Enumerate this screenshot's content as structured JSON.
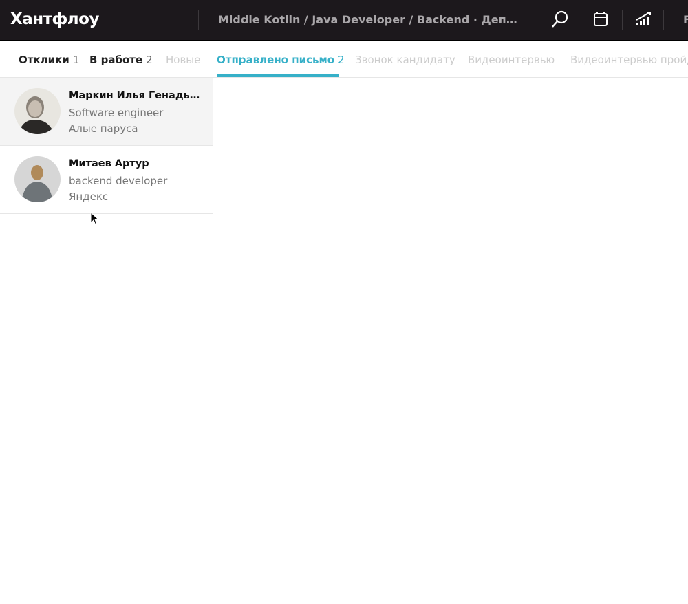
{
  "header": {
    "logo": "Хантфлоу",
    "breadcrumb": "Middle Kotlin / Java Developer / Backend · Департамент разработки",
    "truncated_item": "F",
    "icons": [
      "search-icon",
      "calendar-icon",
      "stats-icon"
    ]
  },
  "tabs": [
    {
      "label": "Отклики",
      "count": "1"
    },
    {
      "label": "В работе",
      "count": "2"
    },
    {
      "label": "Новые"
    },
    {
      "label": "Отправлено письмо",
      "count": "2"
    },
    {
      "label": "Звонок кандидату"
    },
    {
      "label": "Видеоинтервью"
    },
    {
      "label": "Видеоинтервью пройдено"
    }
  ],
  "candidates": [
    {
      "name": "Маркин Илья Генадьевич",
      "role": "Software engineer",
      "company": "Алые паруса"
    },
    {
      "name": "Митаев Артур",
      "role": "backend developer",
      "company": "Яндекс"
    }
  ],
  "colors": {
    "accent": "#36b0c8",
    "header_bg": "#1c181c"
  }
}
